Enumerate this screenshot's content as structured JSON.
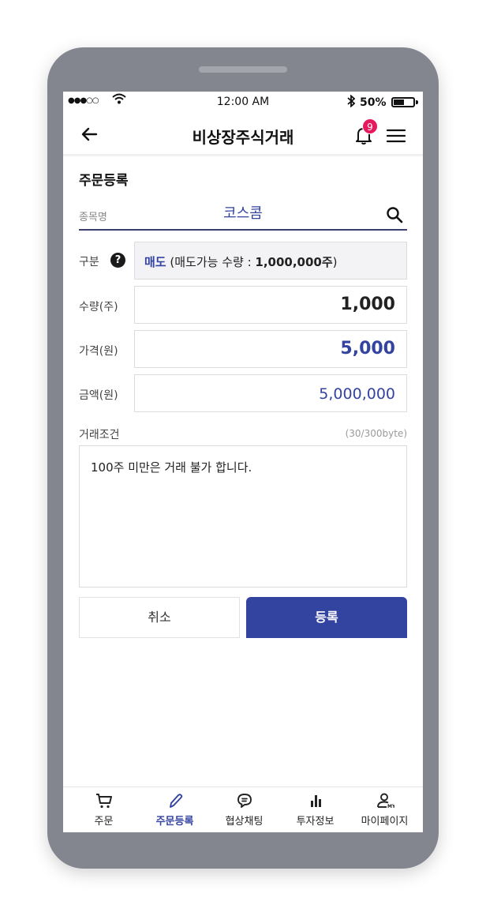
{
  "status_bar": {
    "signal": "●●●○○",
    "time": "12:00 AM",
    "battery": "50%"
  },
  "header": {
    "title": "비상장주식거래",
    "notification_count": "9"
  },
  "page": {
    "section_title": "주문등록",
    "stock": {
      "label": "종목명",
      "name": "코스콤"
    },
    "type": {
      "label": "구분",
      "help": "?",
      "side": "매도",
      "available_prefix": " (매도가능 수량 : ",
      "available_qty": "1,000,000주",
      "available_suffix": ")"
    },
    "quantity": {
      "label": "수량(주)",
      "value": "1,000"
    },
    "price": {
      "label": "가격(원)",
      "value": "5,000"
    },
    "amount": {
      "label": "금액(원)",
      "value": "5,000,000"
    },
    "conditions": {
      "label": "거래조건",
      "byte_count": "(30/300byte)",
      "text": "100주 미만은 거래 불가 합니다."
    },
    "buttons": {
      "cancel": "취소",
      "submit": "등록"
    }
  },
  "bottom_nav": {
    "items": [
      {
        "label": "주문",
        "icon": "cart-icon"
      },
      {
        "label": "주문등록",
        "icon": "pencil-icon",
        "active": true
      },
      {
        "label": "협상채팅",
        "icon": "chat-icon"
      },
      {
        "label": "투자정보",
        "icon": "bar-chart-icon"
      },
      {
        "label": "마이페이지",
        "icon": "user-my-icon"
      }
    ]
  },
  "colors": {
    "accent": "#3343a0",
    "badge": "#e5195e",
    "frame": "#83858f"
  }
}
